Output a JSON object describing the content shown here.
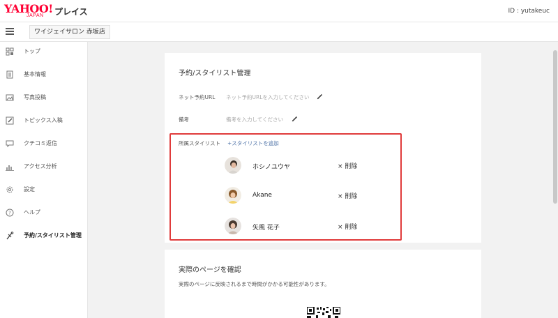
{
  "header": {
    "logo_yahoo": "YAHOO!",
    "logo_japan": "JAPAN",
    "logo_product": "プレイス",
    "user_id": "ID : yutakeuc"
  },
  "subbar": {
    "menu_icon": "hamburger-icon",
    "store_name": "ワイジェイサロン 赤坂店"
  },
  "sidebar": {
    "items": [
      {
        "label": "トップ",
        "icon": "dashboard-icon"
      },
      {
        "label": "基本情報",
        "icon": "document-icon"
      },
      {
        "label": "写真投稿",
        "icon": "photo-icon"
      },
      {
        "label": "トピックス入稿",
        "icon": "pencil-icon"
      },
      {
        "label": "クチコミ返信",
        "icon": "chat-icon"
      },
      {
        "label": "アクセス分析",
        "icon": "bar-chart-icon"
      },
      {
        "label": "設定",
        "icon": "gear-icon"
      },
      {
        "label": "ヘルプ",
        "icon": "help-icon"
      },
      {
        "label": "予約/スタイリスト管理",
        "icon": "scissors-icon",
        "active": true
      }
    ]
  },
  "main": {
    "title": "予約/スタイリスト管理",
    "reservation_url": {
      "label": "ネット予約URL",
      "placeholder": "ネット予約URLを入力してください"
    },
    "notes": {
      "label": "備考",
      "placeholder": "備考を入力してください"
    },
    "stylists": {
      "label": "所属スタイリスト",
      "add_label": "+スタイリストを追加",
      "delete_label": "× 削除",
      "items": [
        {
          "name": "ホシノユウヤ"
        },
        {
          "name": "Akane"
        },
        {
          "name": "矢風 花子"
        }
      ]
    }
  },
  "preview": {
    "title": "実際のページを確認",
    "note": "実際のページに反映されるまで時間がかかる可能性があります。"
  },
  "colors": {
    "accent_red": "#e03b3b",
    "link_blue": "#4a6fa5",
    "brand_red": "#ff0033"
  }
}
